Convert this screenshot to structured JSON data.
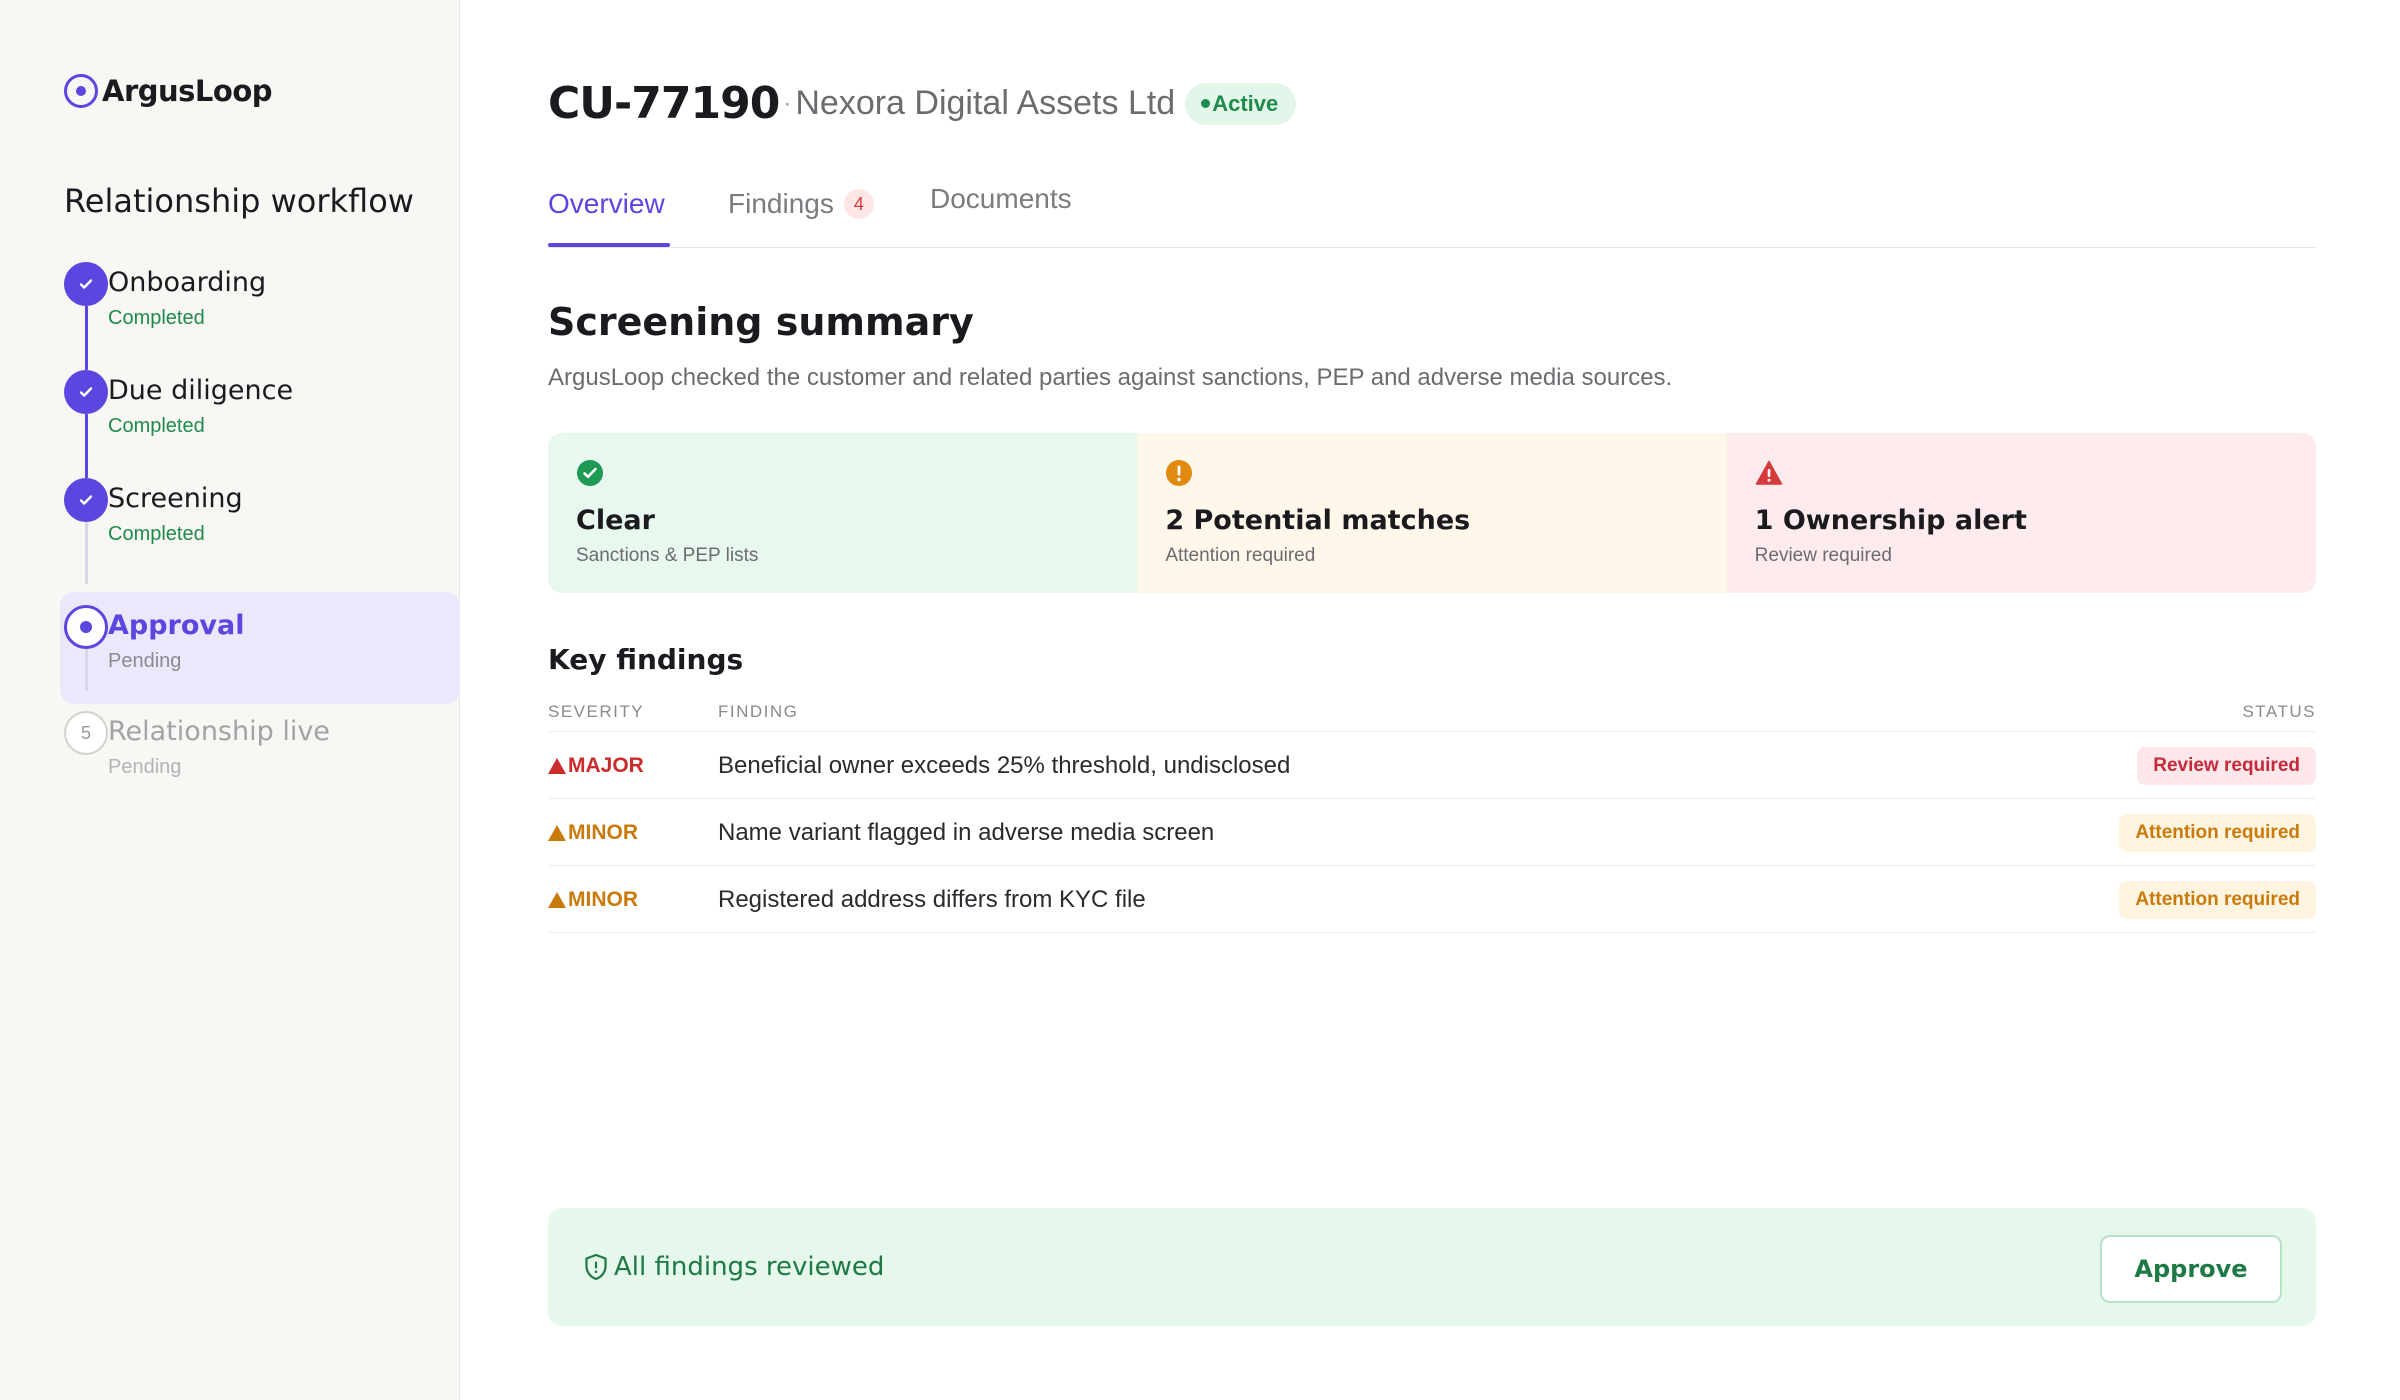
{
  "app": {
    "name": "ArgusLoop"
  },
  "sidebar": {
    "title": "Relationship workflow",
    "steps": [
      {
        "label": "Onboarding",
        "status": "Completed",
        "state": "done"
      },
      {
        "label": "Due diligence",
        "status": "Completed",
        "state": "done"
      },
      {
        "label": "Screening",
        "status": "Completed",
        "state": "done"
      },
      {
        "label": "Approval",
        "status": "Pending",
        "state": "current"
      },
      {
        "label": "Relationship live",
        "status": "Pending",
        "state": "todo",
        "number": "5"
      }
    ]
  },
  "header": {
    "customer_id": "CU-77190",
    "separator": "·",
    "customer_name": "Nexora Digital Assets Ltd",
    "status_badge": "Active"
  },
  "tabs": [
    {
      "label": "Overview",
      "active": true
    },
    {
      "label": "Findings",
      "count": "4"
    },
    {
      "label": "Documents"
    }
  ],
  "summary": {
    "title": "Screening summary",
    "description": "ArgusLoop checked the customer and related parties against sanctions, PEP and adverse media sources.",
    "cards": [
      {
        "title": "Clear",
        "subtitle": "Sanctions & PEP lists",
        "icon": "check-circle-icon",
        "color": "#1e9a55"
      },
      {
        "title": "2 Potential matches",
        "subtitle": "Attention required",
        "icon": "exclamation-circle-icon",
        "color": "#e08a10"
      },
      {
        "title": "1 Ownership alert",
        "subtitle": "Review required",
        "icon": "warning-triangle-icon",
        "color": "#d43a3a"
      }
    ]
  },
  "key_findings": {
    "title": "Key findings",
    "columns": {
      "severity": "SEVERITY",
      "finding": "FINDING",
      "status": "STATUS"
    },
    "rows": [
      {
        "severity": "MAJOR",
        "finding": "Beneficial owner exceeds 25% threshold, undisclosed",
        "status": "Review required"
      },
      {
        "severity": "MINOR",
        "finding": "Name variant flagged in adverse media screen",
        "status": "Attention required"
      },
      {
        "severity": "MINOR",
        "finding": "Registered address differs from KYC file",
        "status": "Attention required"
      }
    ]
  },
  "footer": {
    "message": "All findings reviewed",
    "approve_label": "Approve"
  },
  "colors": {
    "accent": "#5b47e0",
    "success": "#1e8b4c",
    "warning": "#c97a0a",
    "danger": "#cc2b2b"
  }
}
